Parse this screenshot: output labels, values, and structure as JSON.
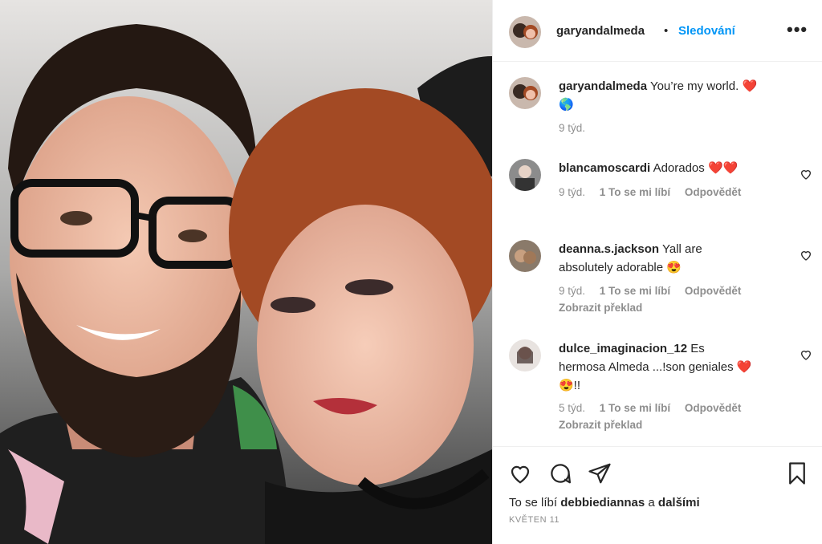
{
  "post": {
    "photo_alt": "selfie photo",
    "author": "garyandalmeda",
    "separator": "•",
    "follow_label": "Sledování",
    "more_label": "•••"
  },
  "caption": {
    "username": "garyandalmeda",
    "text": "You’re my world. ❤️",
    "text_line2": "🌎",
    "time": "9 týd."
  },
  "comments": [
    {
      "username": "blancamoscardi",
      "text": "Adorados ❤️❤️",
      "time": "9 týd.",
      "likes": "1 To se mi líbí",
      "reply": "Odpovědět"
    },
    {
      "username": "deanna.s.jackson",
      "text": "Yall are",
      "text_line2": "absolutely adorable 😍",
      "time": "9 týd.",
      "likes": "1 To se mi líbí",
      "reply": "Odpovědět",
      "translate": "Zobrazit překlad"
    },
    {
      "username": "dulce_imaginacion_12",
      "text": "Es",
      "text_line2": "hermosa Almeda ...!son geniales ❤️",
      "text_line3": "😍!!",
      "time": "5 týd.",
      "likes": "1 To se mi líbí",
      "reply": "Odpovědět",
      "translate": "Zobrazit překlad"
    }
  ],
  "footer": {
    "likes_prefix": "To se líbí",
    "likes_user": "debbiediannas",
    "likes_joiner": "a",
    "likes_others": "dalšími",
    "date": "KVĚTEN 11"
  },
  "icons": {
    "like": "heart-icon",
    "comment": "comment-icon",
    "share": "share-icon",
    "save": "bookmark-icon",
    "more": "more-icon"
  },
  "colors": {
    "accent": "#0095f6",
    "muted": "#8e8e8e",
    "text": "#262626"
  }
}
